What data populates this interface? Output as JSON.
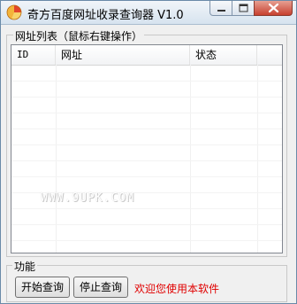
{
  "window": {
    "title": "奇方百度网址收录查询器 V1.0"
  },
  "icons": {
    "app": "pie-chart-app-icon",
    "minimize": "minimize-icon",
    "maximize": "maximize-icon",
    "close": "close-icon"
  },
  "url_group": {
    "title": "网址列表（鼠标右键操作）",
    "columns": [
      "ID",
      "网址",
      "状态",
      ""
    ],
    "watermark": "WWW.9UPK.COM"
  },
  "function_group": {
    "title": "功能",
    "start_label": "开始查询",
    "stop_label": "停止查询",
    "welcome": "欢迎您使用本软件"
  },
  "colors": {
    "welcome_text": "#e00000",
    "close_button": "#c7402f"
  }
}
